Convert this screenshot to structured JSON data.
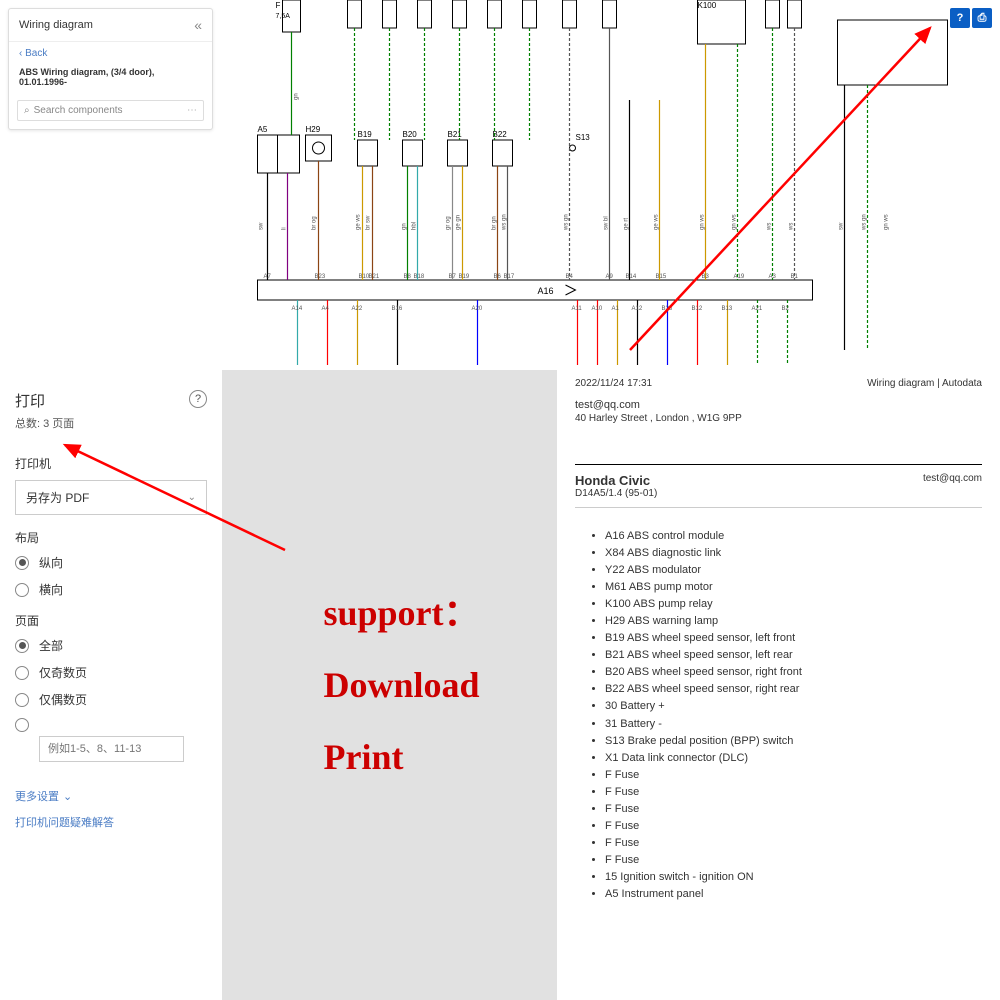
{
  "sidebar": {
    "title": "Wiring diagram",
    "back": "‹ Back",
    "subtitle": "ABS Wiring diagram, (3/4 door), 01.01.1996-",
    "search_placeholder": "Search components"
  },
  "topIcons": {
    "help": "?",
    "print_icon": "⎙"
  },
  "diagram": {
    "topBoxes": {
      "F": "F",
      "F_val": "7,5A",
      "K100": "K100"
    },
    "midBoxes": {
      "A5": "A5",
      "H29": "H29",
      "B19": "B19",
      "B20": "B20",
      "B21": "B21",
      "B22": "B22",
      "S13": "S13"
    },
    "wireLabels": [
      "gn",
      "sw",
      "li",
      "br og",
      "ge ws",
      "br sw",
      "gn",
      "hbl",
      "gr og",
      "ge gn",
      "br gn",
      "ws gn",
      "ws gn",
      "sw bl",
      "ge rt",
      "ge ws",
      "gn ws",
      "gn ws",
      "ws",
      "ws",
      "sw",
      "ws gn",
      "gn ws"
    ],
    "pins_upper": [
      "A7",
      "B23",
      "B10",
      "B21",
      "B8",
      "B18",
      "B7",
      "B19",
      "B6",
      "B17",
      "B4",
      "A9",
      "B14",
      "B15",
      "B3",
      "A19",
      "A3",
      "B1"
    ],
    "pins_lower": [
      "A14",
      "A4",
      "A22",
      "B16",
      "A20",
      "A11",
      "A10",
      "A1",
      "A12",
      "B25",
      "B12",
      "B13",
      "A21",
      "B2"
    ],
    "A16": "A16"
  },
  "print": {
    "title": "打印",
    "total": "总数: 3 页面",
    "printer_label": "打印机",
    "printer_value": "另存为 PDF",
    "layout_label": "布局",
    "layout_portrait": "纵向",
    "layout_landscape": "横向",
    "pages_label": "页面",
    "pages_all": "全部",
    "pages_odd": "仅奇数页",
    "pages_even": "仅偶数页",
    "pages_custom_placeholder": "例如1-5、8、11-13",
    "more_settings": "更多设置",
    "more_settings_chevron": "⌄",
    "troubleshoot": "打印机问题疑难解答"
  },
  "annotation": {
    "line1": "support：",
    "line2": "Download",
    "line3": "Print"
  },
  "doc": {
    "date": "2022/11/24 17:31",
    "source": "Wiring diagram | Autodata",
    "email": "test@qq.com",
    "email2": "test@qq.com",
    "address": "40 Harley Street , London , W1G 9PP",
    "car": "Honda Civic",
    "engine": "D14A5/1.4 (95-01)",
    "components": [
      "A16 ABS control module",
      "X84 ABS diagnostic link",
      "Y22 ABS modulator",
      "M61 ABS pump motor",
      "K100 ABS pump relay",
      "H29 ABS warning lamp",
      "B19 ABS wheel speed sensor, left front",
      "B21 ABS wheel speed sensor, left rear",
      "B20 ABS wheel speed sensor, right front",
      "B22 ABS wheel speed sensor, right rear",
      "30 Battery +",
      "31 Battery -",
      "S13 Brake pedal position (BPP) switch",
      "X1 Data link connector (DLC)",
      "F Fuse",
      "F Fuse",
      "F Fuse",
      "F Fuse",
      "F Fuse",
      "F Fuse",
      "15 Ignition switch - ignition ON",
      "A5 Instrument panel"
    ]
  }
}
